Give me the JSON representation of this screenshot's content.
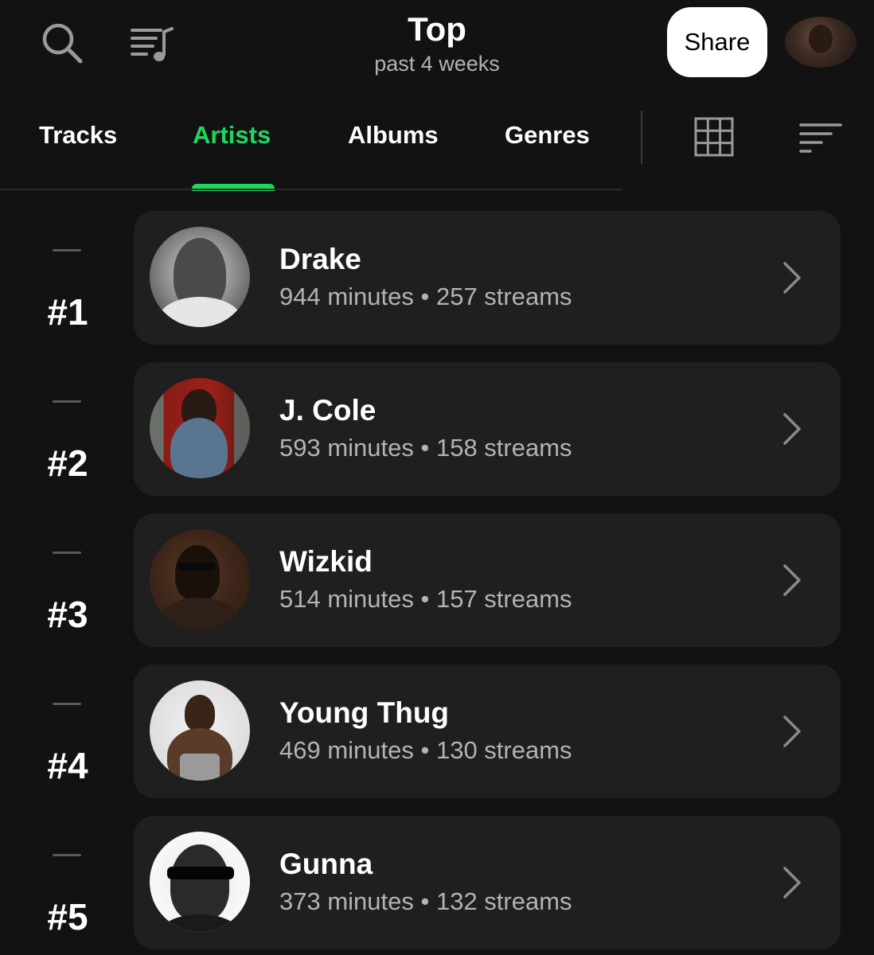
{
  "header": {
    "title": "Top",
    "subtitle": "past 4 weeks",
    "share_label": "Share"
  },
  "tabs": [
    {
      "label": "Tracks",
      "active": false
    },
    {
      "label": "Artists",
      "active": true
    },
    {
      "label": "Albums",
      "active": false
    },
    {
      "label": "Genres",
      "active": false
    }
  ],
  "colors": {
    "accent": "#1ed760",
    "background": "#121212",
    "card": "#1f1f1f",
    "secondary_text": "#b3b3b3"
  },
  "icons": [
    "search-icon",
    "queue-icon",
    "grid-view-icon",
    "sort-icon",
    "chevron-right-icon"
  ],
  "artists": [
    {
      "rank": "#1",
      "name": "Drake",
      "stats": "944 minutes • 257 streams"
    },
    {
      "rank": "#2",
      "name": "J. Cole",
      "stats": "593 minutes • 158 streams"
    },
    {
      "rank": "#3",
      "name": "Wizkid",
      "stats": "514 minutes • 157 streams"
    },
    {
      "rank": "#4",
      "name": "Young Thug",
      "stats": "469 minutes • 130 streams"
    },
    {
      "rank": "#5",
      "name": "Gunna",
      "stats": "373 minutes • 132 streams"
    }
  ]
}
